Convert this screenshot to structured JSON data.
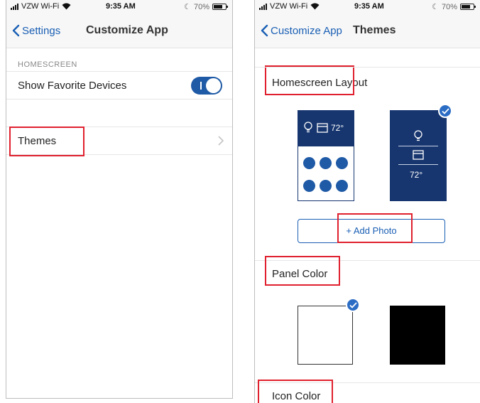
{
  "status_bar": {
    "carrier": "VZW Wi-Fi",
    "time": "9:35 AM",
    "battery": "70%"
  },
  "customize_screen": {
    "back_label": "Settings",
    "title": "Customize App",
    "section_header": "HOMESCREEN",
    "show_favorites_label": "Show Favorite Devices",
    "show_favorites_on": true,
    "themes_label": "Themes"
  },
  "themes_screen": {
    "back_label": "Customize App",
    "title": "Themes",
    "homescreen_layout_title": "Homescreen Layout",
    "layout_options": [
      {
        "temperature": "72°",
        "selected": false
      },
      {
        "temperature": "72°",
        "selected": true
      }
    ],
    "add_photo_label": "+ Add Photo",
    "panel_color_title": "Panel Color",
    "panel_colors": [
      {
        "color": "#ffffff",
        "selected": true
      },
      {
        "color": "#000000",
        "selected": false
      }
    ],
    "icon_color_title": "Icon Color"
  },
  "colors": {
    "accent": "#1a5fb4",
    "toggle_on": "#1f5aa6",
    "layout_navy": "#17366f",
    "highlight_red": "#e0202e"
  }
}
